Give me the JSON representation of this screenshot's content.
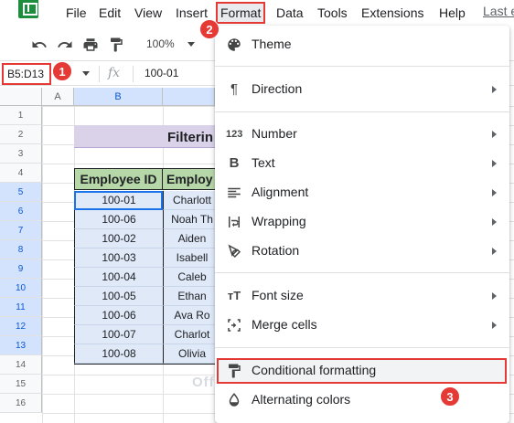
{
  "menu": {
    "items": [
      "File",
      "Edit",
      "View",
      "Insert",
      "Format",
      "Data",
      "Tools",
      "Extensions",
      "Help"
    ],
    "link": "Last e",
    "active": "Format"
  },
  "toolbar": {
    "zoom": "100%",
    "icons": [
      "undo-icon",
      "redo-icon",
      "print-icon",
      "paint-format-icon"
    ]
  },
  "formula_bar": {
    "name_box": "B5:D13",
    "fx": "fx",
    "value": "100-01"
  },
  "badges": [
    "1",
    "2",
    "3"
  ],
  "grid": {
    "columns": [
      "A",
      "B"
    ],
    "rows": [
      "1",
      "2",
      "3",
      "4",
      "5",
      "6",
      "7",
      "8",
      "9",
      "10",
      "11",
      "12",
      "13",
      "14",
      "15",
      "16"
    ]
  },
  "sheet": {
    "title": "Filterin",
    "headers": [
      "Employee ID",
      "Employ"
    ],
    "rows": [
      {
        "id": "100-01",
        "name": "Charlott"
      },
      {
        "id": "100-06",
        "name": "Noah Th"
      },
      {
        "id": "100-02",
        "name": "Aiden"
      },
      {
        "id": "100-03",
        "name": "Isabell"
      },
      {
        "id": "100-04",
        "name": "Caleb"
      },
      {
        "id": "100-05",
        "name": "Ethan"
      },
      {
        "id": "100-06",
        "name": "Ava Ro"
      },
      {
        "id": "100-07",
        "name": "Charlot"
      },
      {
        "id": "100-08",
        "name": "Olivia"
      }
    ]
  },
  "format_menu": {
    "items": [
      {
        "label": "Theme",
        "icon": "palette-icon",
        "submenu": false
      },
      {
        "label": "Direction",
        "icon": "pilcrow-icon",
        "submenu": true
      },
      {
        "label": "Number",
        "icon": "number-format-icon",
        "submenu": true
      },
      {
        "label": "Text",
        "icon": "bold-icon",
        "submenu": true
      },
      {
        "label": "Alignment",
        "icon": "align-left-icon",
        "submenu": true
      },
      {
        "label": "Wrapping",
        "icon": "wrap-icon",
        "submenu": true
      },
      {
        "label": "Rotation",
        "icon": "rotation-icon",
        "submenu": true
      },
      {
        "label": "Font size",
        "icon": "font-size-icon",
        "submenu": true
      },
      {
        "label": "Merge cells",
        "icon": "merge-icon",
        "submenu": true
      },
      {
        "label": "Conditional formatting",
        "icon": "paint-roller-icon",
        "submenu": false
      },
      {
        "label": "Alternating colors",
        "icon": "drop-icon",
        "submenu": false
      }
    ]
  },
  "watermark": "OfficeWheel",
  "colors": {
    "accent_red": "#e53935",
    "header_green": "#b6d7a8",
    "title_purple": "#d9d2e9",
    "cell_blue": "#dfe9f8",
    "selection_blue": "#1a73e8"
  }
}
